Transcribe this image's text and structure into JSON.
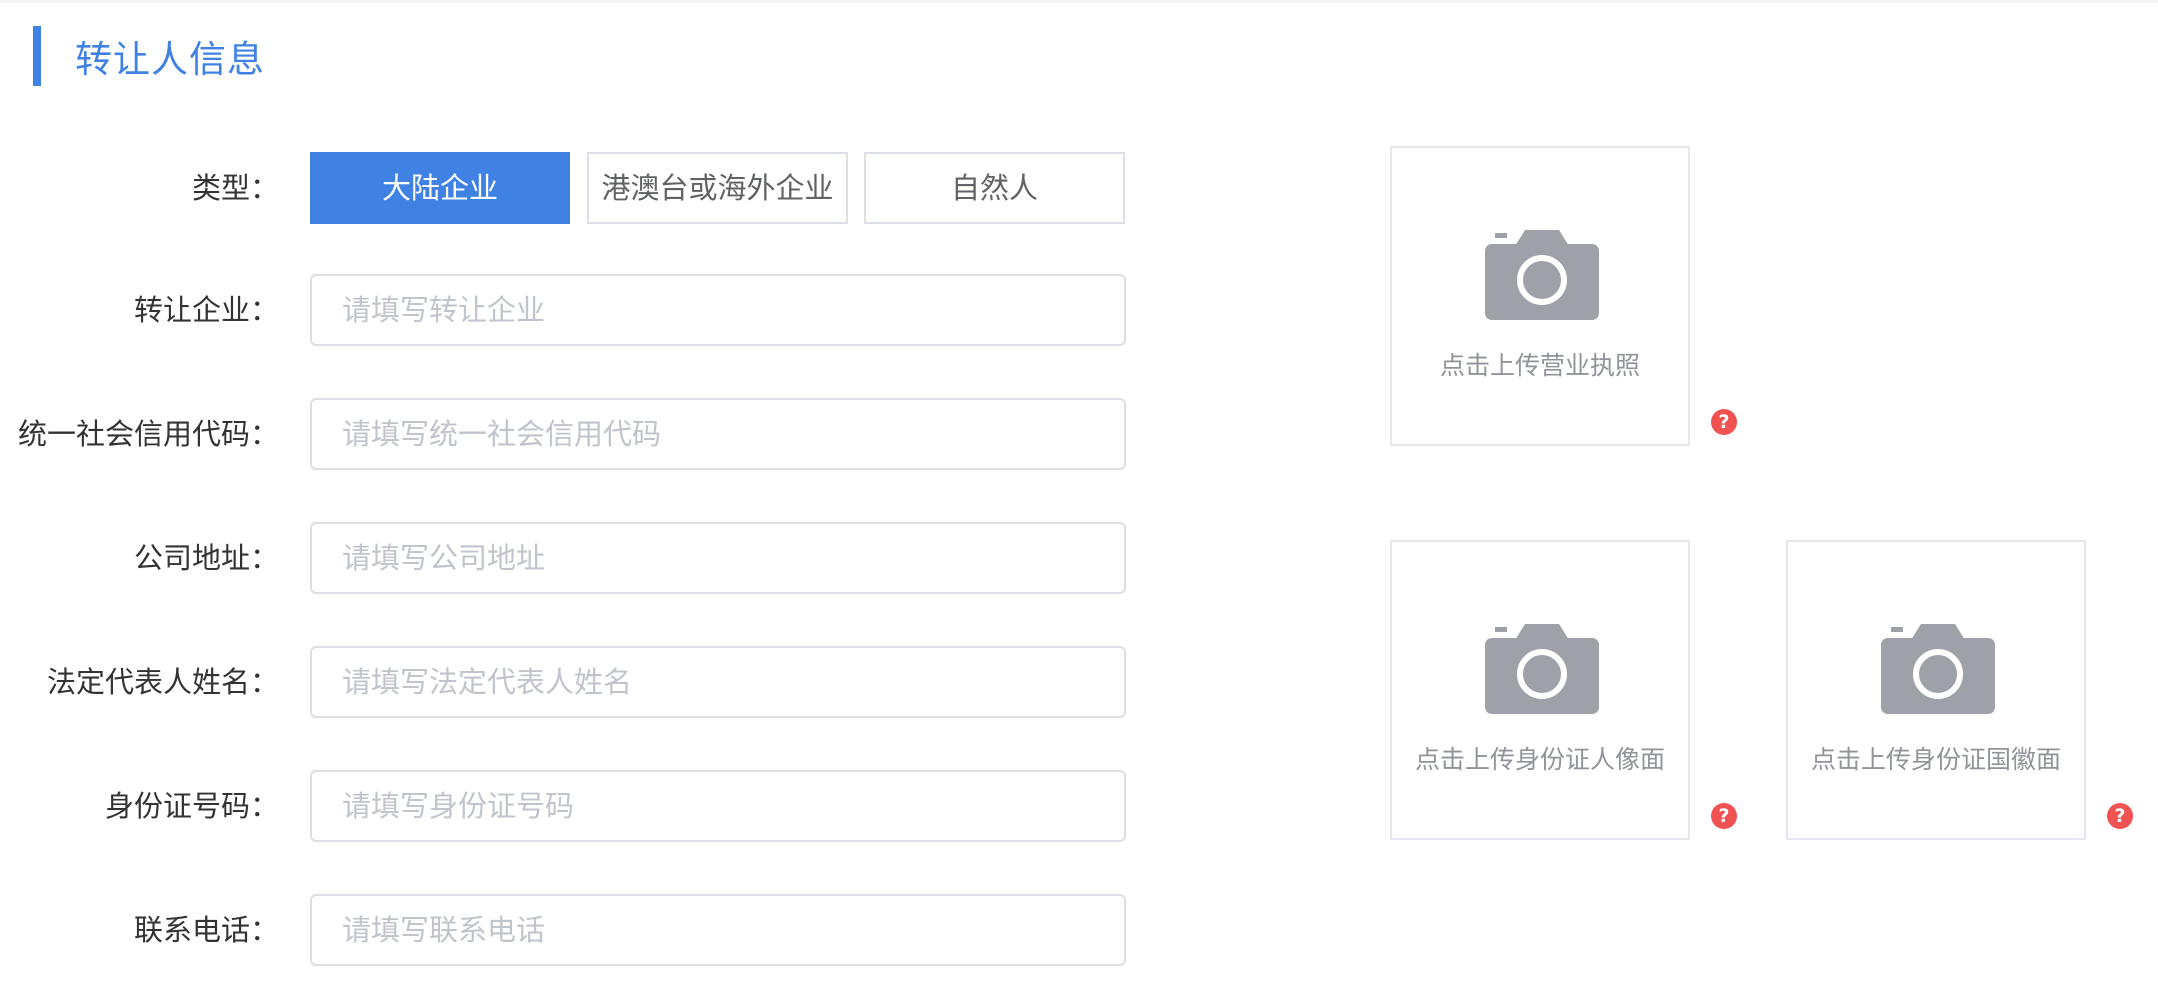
{
  "section": {
    "title": "转让人信息"
  },
  "form": {
    "type": {
      "label": "类型：",
      "options": [
        "大陆企业",
        "港澳台或海外企业",
        "自然人"
      ],
      "selected": "大陆企业"
    },
    "fields": [
      {
        "label": "转让企业：",
        "value": "",
        "placeholder": "请填写转让企业"
      },
      {
        "label": "统一社会信用代码：",
        "value": "",
        "placeholder": "请填写统一社会信用代码"
      },
      {
        "label": "公司地址：",
        "value": "",
        "placeholder": "请填写公司地址"
      },
      {
        "label": "法定代表人姓名：",
        "value": "",
        "placeholder": "请填写法定代表人姓名"
      },
      {
        "label": "身份证号码：",
        "value": "",
        "placeholder": "请填写身份证号码"
      },
      {
        "label": "联系电话：",
        "value": "",
        "placeholder": "请填写联系电话"
      }
    ]
  },
  "uploads": [
    {
      "label": "点击上传营业执照",
      "icon": "camera-icon",
      "help_icon": "question-icon",
      "help_glyph": "?"
    },
    {
      "label": "点击上传身份证人像面",
      "icon": "camera-icon",
      "help_icon": "question-icon",
      "help_glyph": "?"
    },
    {
      "label": "点击上传身份证国徽面",
      "icon": "camera-icon",
      "help_icon": "question-icon",
      "help_glyph": "?"
    }
  ],
  "colors": {
    "accent": "#3f82e4",
    "help_badge": "#f05252",
    "camera_icon": "#9ea1a7",
    "placeholder_text": "#c0c4cc",
    "border": "#dcdfe6"
  }
}
